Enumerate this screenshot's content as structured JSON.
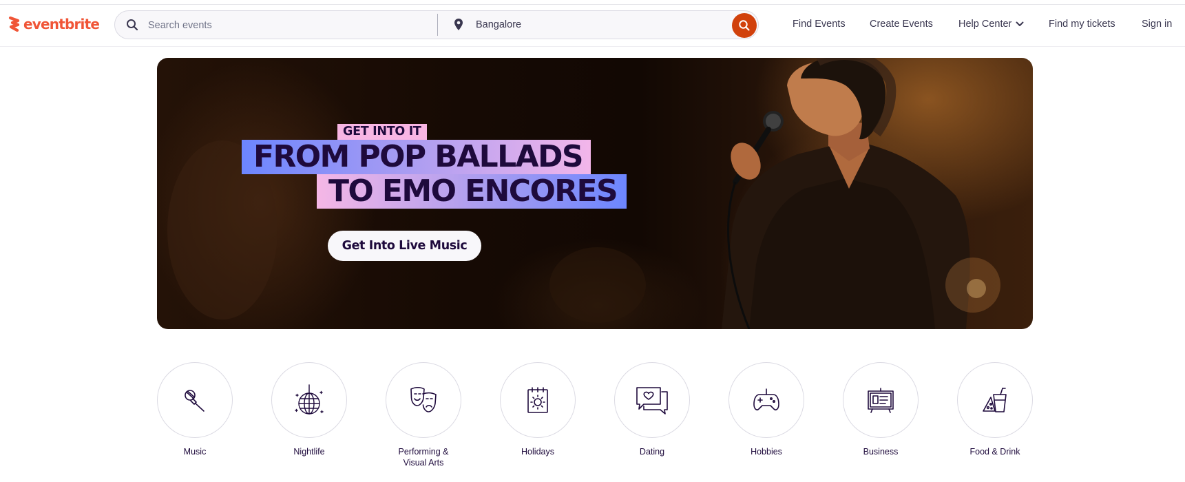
{
  "brand": {
    "logo_text": "eventbrite",
    "accent_color": "#d1410c",
    "logo_color": "#f05537"
  },
  "search": {
    "placeholder": "Search events",
    "location": "Bangalore",
    "search_icon": "search-icon",
    "location_icon": "map-pin-icon",
    "submit_icon": "search-icon"
  },
  "nav": {
    "find_events": "Find Events",
    "create_events": "Create Events",
    "help_center": "Help Center",
    "help_center_icon": "chevron-down-icon",
    "find_tickets": "Find my tickets",
    "sign_in": "Sign in"
  },
  "hero": {
    "kicker": "GET INTO IT",
    "line1": "FROM POP BALLADS",
    "line2": "TO EMO ENCORES",
    "cta": "Get Into Live Music"
  },
  "categories": [
    {
      "label": "Music",
      "icon": "microphone-icon"
    },
    {
      "label": "Nightlife",
      "icon": "disco-ball-icon"
    },
    {
      "label": "Performing & Visual Arts",
      "icon": "theater-masks-icon"
    },
    {
      "label": "Holidays",
      "icon": "calendar-icon"
    },
    {
      "label": "Dating",
      "icon": "chat-heart-icon"
    },
    {
      "label": "Hobbies",
      "icon": "gamepad-icon"
    },
    {
      "label": "Business",
      "icon": "presentation-board-icon"
    },
    {
      "label": "Food & Drink",
      "icon": "food-drink-icon"
    }
  ]
}
